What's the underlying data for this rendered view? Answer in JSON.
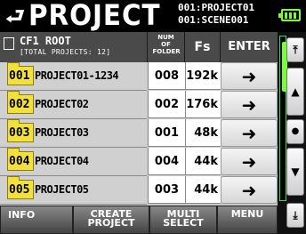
{
  "header": {
    "back_icon": "back-arrow-icon",
    "title": "PROJECT",
    "project_line": "001:PROJECT01",
    "scene_line": "001:SCENE001",
    "battery_icon": "battery-icon",
    "battery_color": "#77ff33"
  },
  "table": {
    "root_label": "CF1 ROOT",
    "total_label": "[TOTAL PROJECTS: 12]",
    "col_num": "NUM OF FOLDER",
    "col_fs": "Fs",
    "col_enter": "ENTER",
    "rows": [
      {
        "index": "001",
        "name": "PROJECT01-1234",
        "num": "008",
        "fs": "192k"
      },
      {
        "index": "002",
        "name": "PROJECT02",
        "num": "002",
        "fs": "176k"
      },
      {
        "index": "003",
        "name": "PROJECT03",
        "num": "001",
        "fs": "48k"
      },
      {
        "index": "004",
        "name": "PROJECT04",
        "num": "004",
        "fs": "44k"
      },
      {
        "index": "005",
        "name": "PROJECT05",
        "num": "003",
        "fs": "44k"
      }
    ]
  },
  "scroll": {
    "top_icon": "scroll-top-icon",
    "up_icon": "scroll-up-icon",
    "down_icon": "scroll-down-icon",
    "bottom_icon": "scroll-bottom-icon"
  },
  "footer": {
    "info": "INFO",
    "create1": "CREATE",
    "create2": "PROJECT",
    "multi1": "MULTI",
    "multi2": "SELECT",
    "menu": "MENU"
  }
}
